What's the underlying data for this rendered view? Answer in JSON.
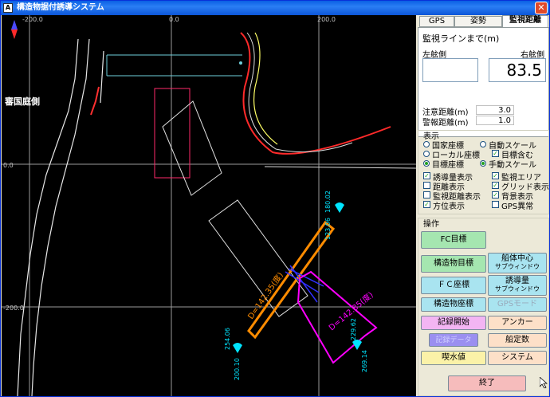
{
  "window": {
    "title": "構造物据付誘導システム"
  },
  "map": {
    "labels": {
      "grid_x_left": "-200.0",
      "grid_x_mid": "0.0",
      "grid_x_right": "200.0",
      "grid_y_zero": "0.0",
      "grid_y_neg": "-200.0",
      "side_label": "審国庭側",
      "distance_orange": "D=142.35(度)",
      "distance_magenta": "D=142.35(度)",
      "anchor_top_a": "180.02",
      "anchor_top_b": "123.06",
      "anchor_left_a": "254.06",
      "anchor_left_b": "200.10",
      "anchor_right_a": "229.62",
      "anchor_right_b": "269.14"
    },
    "colors": {
      "background": "#000000",
      "target": "#ff8c00",
      "structure": "#ff00ff",
      "coast": "#ffffff",
      "grid": "#c0c0c0"
    }
  },
  "tabs": [
    {
      "label": "GPS"
    },
    {
      "label": "姿勢"
    },
    {
      "label": "監視距離",
      "active": true
    }
  ],
  "monitor": {
    "heading": "監視ラインまで(m)",
    "left_side": "左舷側",
    "right_side": "右舷側",
    "left_value": "",
    "right_value": "83.5",
    "caution_label": "注意距離(m)",
    "caution_value": "3.0",
    "warning_label": "警報距離(m)",
    "warning_value": "1.0"
  },
  "display": {
    "title": "表示",
    "radios": [
      {
        "label": "国家座標",
        "on": false
      },
      {
        "label": "自動スケール",
        "on": false
      },
      {
        "label": "ローカル座標",
        "on": false
      },
      {
        "label": "目標座標",
        "on": true
      },
      {
        "label": "手動スケール",
        "on": true
      }
    ],
    "checkbox_target_include": {
      "label": "目標含む",
      "checked": true
    },
    "checks": [
      {
        "label": "誘導量表示",
        "checked": true
      },
      {
        "label": "監視エリア",
        "checked": true
      },
      {
        "label": "距離表示",
        "checked": false
      },
      {
        "label": "グリッド表示",
        "checked": true
      },
      {
        "label": "監視距離表示",
        "checked": false
      },
      {
        "label": "背景表示",
        "checked": true
      },
      {
        "label": "方位表示",
        "checked": true
      },
      {
        "label": "GPS異常",
        "checked": false
      }
    ]
  },
  "operation": {
    "title": "操作",
    "fc_target": "FC目標",
    "structure_target": "構造物目標",
    "hull_center_1": "船体中心",
    "hull_center_2": "サブウィンドウ",
    "fc_coord": "ＦＣ座標",
    "guidance_1": "誘導量",
    "guidance_2": "サブウィンドウ",
    "structure_coord": "構造物座標",
    "gps_mode": "GPSモード",
    "record_start": "記録開始",
    "anchor": "アンカー",
    "record_data": "記録データ",
    "hull_constant": "船定数",
    "draft": "喫水値",
    "system": "システム",
    "exit": "終了"
  }
}
